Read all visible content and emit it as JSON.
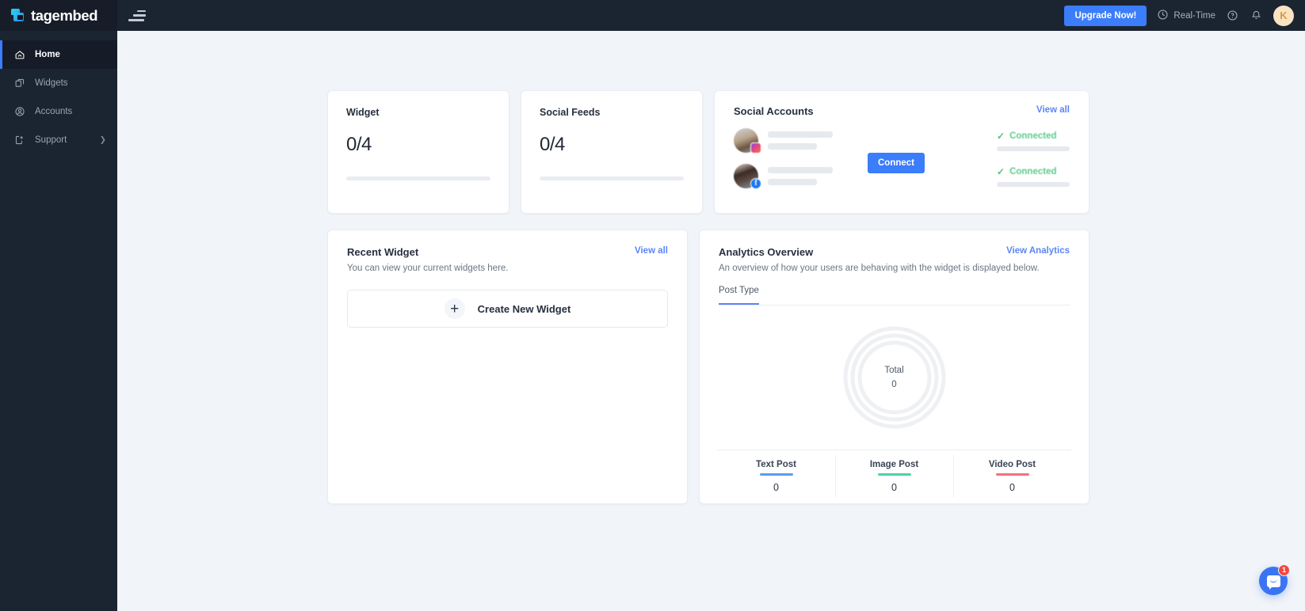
{
  "brand": {
    "name": "tagembed",
    "logo_icon": "tagembed-logo-icon"
  },
  "sidebar": {
    "items": [
      {
        "label": "Home",
        "icon": "home-icon",
        "active": true,
        "has_chevron": false
      },
      {
        "label": "Widgets",
        "icon": "widgets-icon",
        "active": false,
        "has_chevron": false
      },
      {
        "label": "Accounts",
        "icon": "accounts-icon",
        "active": false,
        "has_chevron": false
      },
      {
        "label": "Support",
        "icon": "support-icon",
        "active": false,
        "has_chevron": true
      }
    ]
  },
  "topbar": {
    "menu_icon": "hamburger-menu-icon",
    "upgrade_label": "Upgrade Now!",
    "realtime_label": "Real-Time",
    "realtime_icon": "clock-icon",
    "help_icon": "help-circle-icon",
    "notification_icon": "bell-icon",
    "avatar_initial": "K"
  },
  "widget_card": {
    "title": "Widget",
    "value": "0/4"
  },
  "feeds_card": {
    "title": "Social Feeds",
    "value": "0/4"
  },
  "social_accounts": {
    "title": "Social Accounts",
    "view_all_label": "View all",
    "connect_label": "Connect",
    "rows": [
      {
        "network": "instagram",
        "badge_icon": "instagram-icon",
        "status": "Connected",
        "status_icon": "check-icon"
      },
      {
        "network": "facebook",
        "badge_icon": "facebook-icon",
        "status": "Connected",
        "status_icon": "check-icon"
      }
    ]
  },
  "recent_widget": {
    "title": "Recent Widget",
    "view_all_label": "View all",
    "subtitle": "You can view your current widgets here.",
    "create_label": "Create New Widget",
    "plus_icon": "plus-icon"
  },
  "analytics": {
    "title": "Analytics Overview",
    "view_analytics_label": "View Analytics",
    "subtitle": "An overview of how your users are behaving with the widget is displayed below.",
    "tabs": [
      {
        "label": "Post Type",
        "active": true
      }
    ]
  },
  "colors": {
    "accent_blue": "#3b7dfb",
    "link_blue": "#5b86f7",
    "text_post": "#5b9bf5",
    "image_post": "#4fd1a5",
    "video_post": "#f4707f",
    "connected_green": "#5dc98c",
    "sidebar_bg": "#1b2431",
    "page_bg": "#f1f4f8"
  },
  "chat": {
    "icon": "chat-bubble-icon",
    "badge": "1"
  },
  "chart_data": {
    "type": "pie",
    "title": "Post Type",
    "center_label": "Total",
    "center_value": "0",
    "total": 0,
    "categories": [
      "Text Post",
      "Image Post",
      "Video Post"
    ],
    "values": [
      0,
      0,
      0
    ],
    "colors": [
      "#5b9bf5",
      "#4fd1a5",
      "#f4707f"
    ],
    "empty_ring_color": "#eef0f3",
    "legend_position": "bottom",
    "rings": 3,
    "xlabel": "",
    "ylabel": ""
  }
}
